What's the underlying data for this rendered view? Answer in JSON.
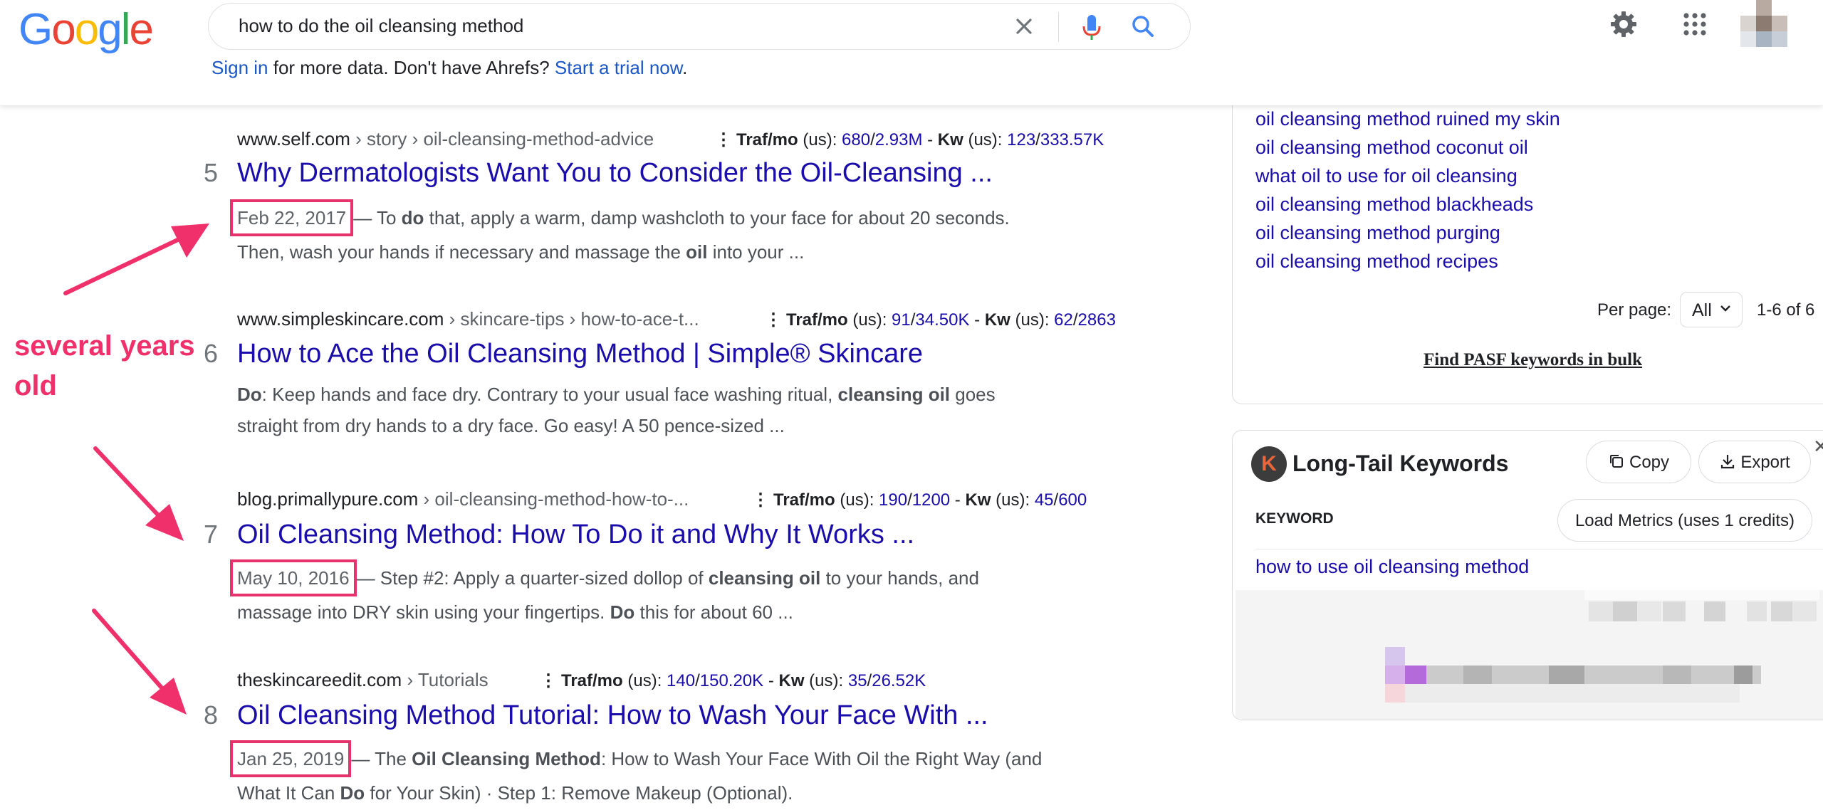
{
  "search": {
    "query": "how to do the oil cleansing method"
  },
  "logo_letters": [
    {
      "ch": "G",
      "color": "#4285f4"
    },
    {
      "ch": "o",
      "color": "#ea4335"
    },
    {
      "ch": "o",
      "color": "#fbbc05"
    },
    {
      "ch": "g",
      "color": "#4285f4"
    },
    {
      "ch": "l",
      "color": "#34a853"
    },
    {
      "ch": "e",
      "color": "#ea4335"
    }
  ],
  "ahrefs_bar": {
    "sign_in": "Sign in",
    "middle": " for more data. Don't have Ahrefs? ",
    "trial": "Start a trial now",
    "end": "."
  },
  "results": [
    {
      "rank": "5",
      "domain": "www.self.com",
      "crumb": " › story › oil-cleansing-method-advice",
      "traf_label": "Traf/mo",
      "traf_region": " (us): ",
      "traf_a": "680",
      "traf_b": "2.93M",
      "kw_label": "Kw",
      "kw_region": " (us): ",
      "kw_a": "123",
      "kw_b": "333.57K",
      "title": "Why Dermatologists Want You to Consider the Oil-Cleansing ...",
      "date": "Feb 22, 2017",
      "snip1_a": "— To ",
      "snip1_b": "do",
      "snip1_c": " that, apply a warm, damp washcloth to your face for about 20 seconds.",
      "snip2_a": "Then, wash your hands if necessary and massage the ",
      "snip2_b": "oil",
      "snip2_c": " into your ..."
    },
    {
      "rank": "6",
      "domain": "www.simpleskincare.com",
      "crumb": " › skincare-tips › how-to-ace-t...",
      "traf_label": "Traf/mo",
      "traf_region": " (us): ",
      "traf_a": "91",
      "traf_b": "34.50K",
      "kw_label": "Kw",
      "kw_region": " (us): ",
      "kw_a": "62",
      "kw_b": "2863",
      "title": "How to Ace the Oil Cleansing Method | Simple® Skincare",
      "snip1_a": "Do",
      "snip1_b": ": Keep hands and face dry. Contrary to your usual face washing ritual, ",
      "snip1_c": "cleansing oil",
      "snip1_d": " goes",
      "snip2": "straight from dry hands to a dry face. Go easy! A 50 pence-sized ..."
    },
    {
      "rank": "7",
      "domain": "blog.primallypure.com",
      "crumb": " › oil-cleansing-method-how-to-...",
      "traf_label": "Traf/mo",
      "traf_region": " (us): ",
      "traf_a": "190",
      "traf_b": "1200",
      "kw_label": "Kw",
      "kw_region": " (us): ",
      "kw_a": "45",
      "kw_b": "600",
      "title": "Oil Cleansing Method: How To Do it and Why It Works ...",
      "date": "May 10, 2016",
      "snip1_a": "— Step #2: Apply a quarter-sized dollop of ",
      "snip1_b": "cleansing oil",
      "snip1_c": " to your hands, and",
      "snip2_a": "massage into DRY skin using your fingertips. ",
      "snip2_b": "Do",
      "snip2_c": " this for about 60 ..."
    },
    {
      "rank": "8",
      "domain": "theskincareedit.com",
      "crumb": " › Tutorials",
      "traf_label": "Traf/mo",
      "traf_region": " (us): ",
      "traf_a": "140",
      "traf_b": "150.20K",
      "kw_label": "Kw",
      "kw_region": " (us): ",
      "kw_a": "35",
      "kw_b": "26.52K",
      "title": "Oil Cleansing Method Tutorial: How to Wash Your Face With ...",
      "date": "Jan 25, 2019",
      "snip1_a": "— The ",
      "snip1_b": "Oil Cleansing Method",
      "snip1_c": ": How to Wash Your Face With Oil the Right Way (and",
      "snip2_a": "What It Can ",
      "snip2_b": "Do",
      "snip2_c": " for Your Skin) · Step 1: Remove Makeup (Optional)."
    }
  ],
  "annotation": {
    "line1": "several years",
    "line2": "old",
    "color": "#f0306b"
  },
  "related": {
    "items": [
      "oil cleansing method ruined my skin",
      "oil cleansing method coconut oil",
      "what oil to use for oil cleansing",
      "oil cleansing method blackheads",
      "oil cleansing method purging",
      "oil cleansing method recipes"
    ],
    "per_page_label": "Per page:",
    "per_page_value": "All",
    "range": "1-6 of 6",
    "find_pasf": "Find PASF keywords in bulk"
  },
  "longtail": {
    "logo_letter": "K",
    "title": "Long-Tail Keywords",
    "copy_label": "Copy",
    "export_label": "Export",
    "keyword_header": "KEYWORD",
    "load_metrics_label": "Load Metrics (uses 1 credits)",
    "first_keyword": "how to use oil cleansing method"
  }
}
